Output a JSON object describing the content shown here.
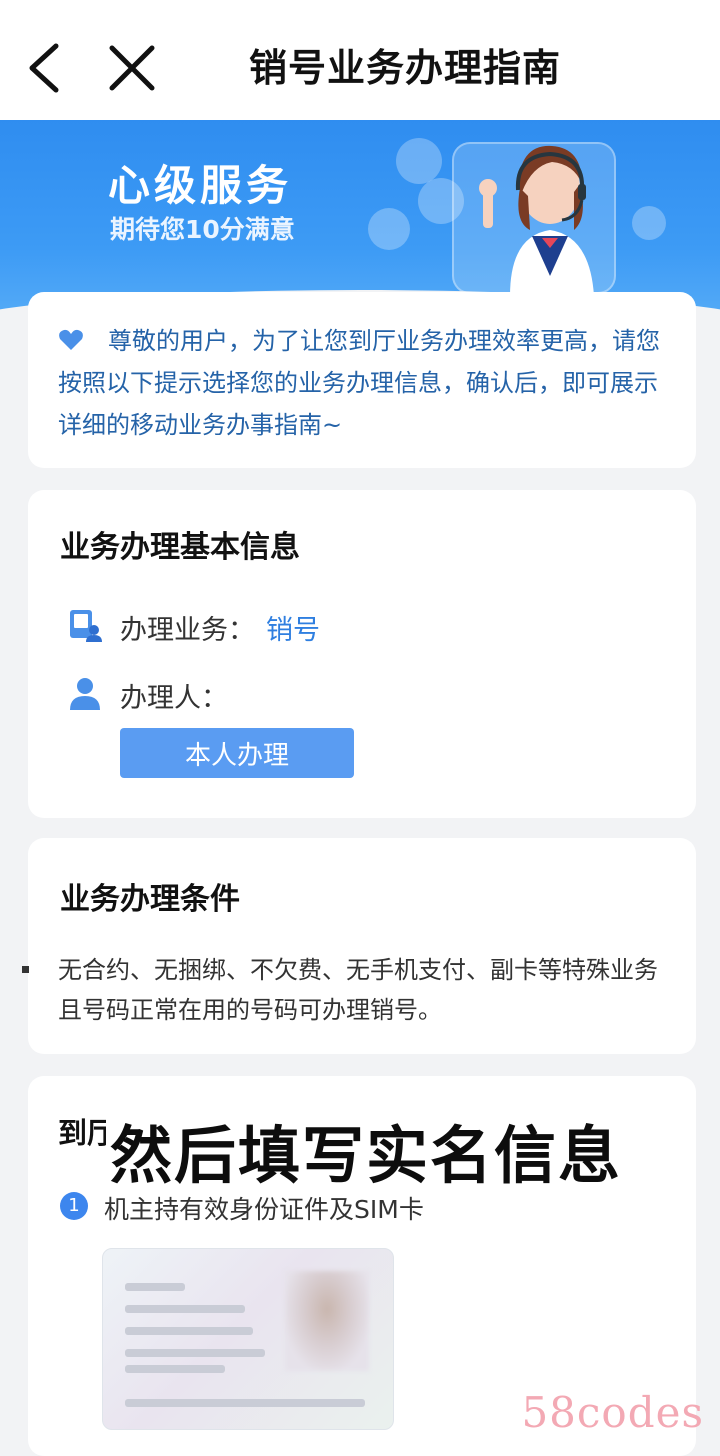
{
  "nav": {
    "title": "销号业务办理指南",
    "back_icon": "chevron-left-icon",
    "close_icon": "close-icon"
  },
  "banner": {
    "title": "心级服务",
    "subtitle": "期待您10分满意"
  },
  "notice": {
    "icon": "heart-icon",
    "text": "尊敬的用户，为了让您到厅业务办理效率更高，请您按照以下提示选择您的业务办理信息，确认后，即可展示详细的移动业务办事指南~"
  },
  "basic_info": {
    "title": "业务办理基本信息",
    "business_label": "办理业务：",
    "business_value": "销号",
    "handler_label": "办理人：",
    "handler_button": "本人办理"
  },
  "conditions": {
    "title": "业务办理条件",
    "text": "无合约、无捆绑、不欠费、无手机支付、副卡等特殊业务且号码正常在用的号码可办理销号。"
  },
  "steps": {
    "partial_title": "到厅",
    "overlay_caption": "然后填写实名信息",
    "items": [
      {
        "num": "1",
        "text": "机主持有效身份证件及SIM卡"
      }
    ]
  },
  "watermark": "58codes",
  "colors": {
    "accent": "#2f7fe0",
    "button": "#5a9cf2",
    "banner": "#2f8df0"
  }
}
